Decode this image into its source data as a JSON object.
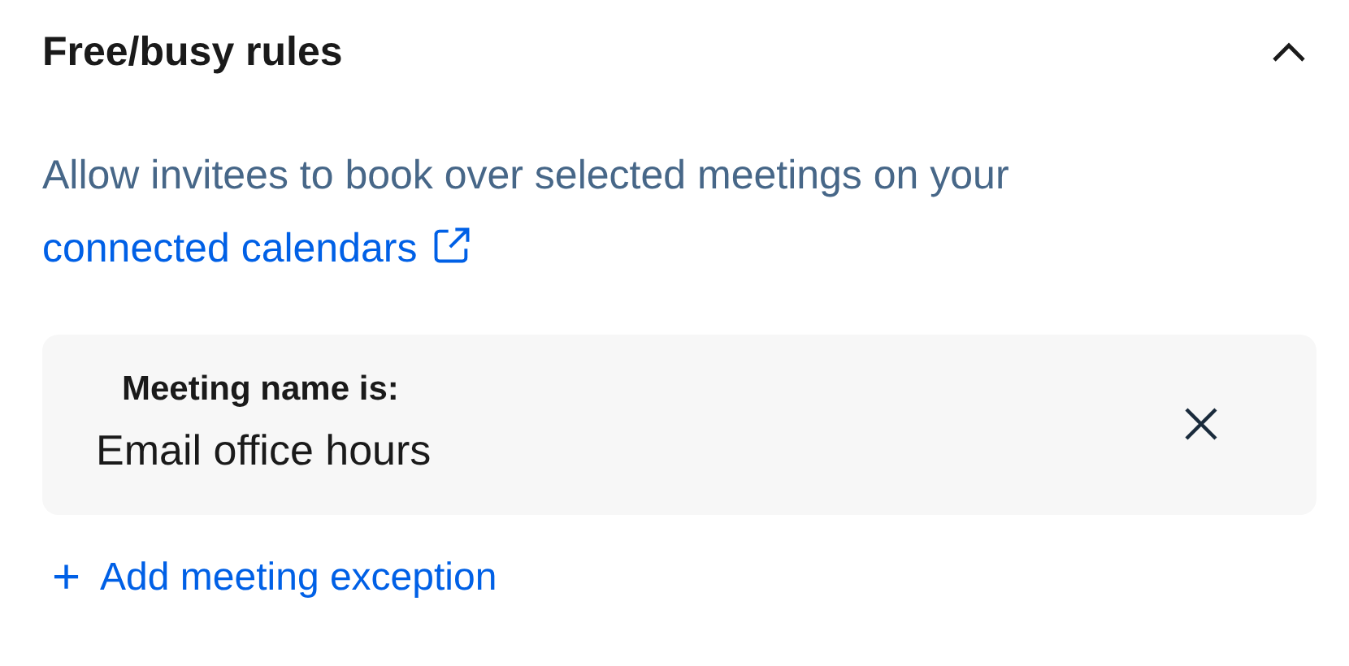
{
  "section": {
    "title": "Free/busy rules",
    "expanded": true
  },
  "description": {
    "text": "Allow invitees to book over selected meetings on your",
    "link": "connected calendars"
  },
  "rules": [
    {
      "label": "Meeting name is:",
      "value": "Email office hours"
    }
  ],
  "add_button": {
    "icon": "+",
    "label": "Add meeting exception"
  }
}
